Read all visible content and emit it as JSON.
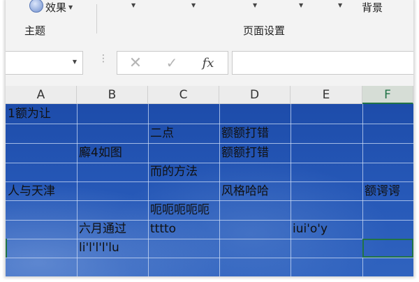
{
  "ribbon": {
    "effects_label": "效果",
    "background_label": "背景",
    "group_theme": "主题",
    "group_page_setup": "页面设置"
  },
  "formula_bar": {
    "name_box_value": "",
    "formula_value": "",
    "fx_label": "fx"
  },
  "icons": {
    "cancel": "close-x-icon",
    "confirm": "check-icon",
    "function": "fx-icon",
    "effects": "theme-effects-icon",
    "dropdown": "chevron-down-icon"
  },
  "sheet": {
    "columns": [
      "A",
      "B",
      "C",
      "D",
      "E",
      "F"
    ],
    "selected_column": "F",
    "cells": {
      "r1": {
        "A": "1额为让"
      },
      "r2": {
        "C": "二点",
        "D": "额额打错"
      },
      "r3": {
        "B": "廨4如图",
        "D": "额额打错"
      },
      "r4": {
        "C": "而的方法"
      },
      "r5": {
        "A": "人与天津",
        "D": "风格哈哈",
        "F": "额谔谔"
      },
      "r6": {
        "C": "呃呃呃呃呃"
      },
      "r7": {
        "B": "六月通过",
        "C": "tttto",
        "E": "iui'o'y"
      },
      "r8": {
        "B": "li'l'l'l'lu"
      }
    }
  },
  "colors": {
    "grid_background": "#2658b7",
    "grid_lines": "#cddcf5",
    "selection": "#217346",
    "ribbon_background": "#f3f3f3"
  }
}
